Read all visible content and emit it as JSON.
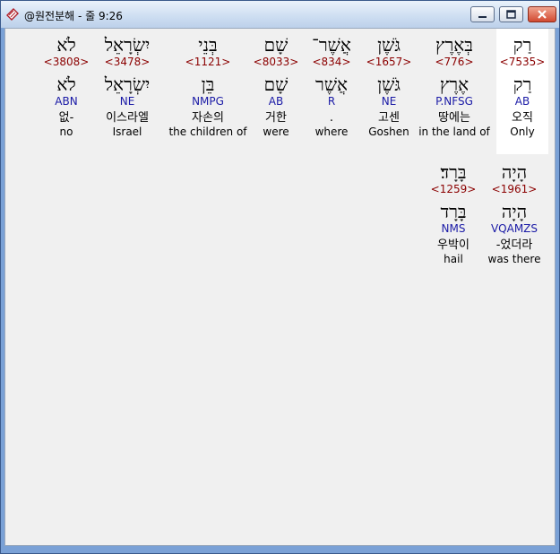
{
  "window": {
    "title": "@원전분해 - 줄 9:26",
    "icon": "bible-tool-icon"
  },
  "rows": [
    {
      "words": [
        {
          "surface": "לֹא",
          "strong": "<3808>",
          "lemma": "לֹא",
          "parse": "ABN",
          "korean": "없-",
          "english": "no"
        },
        {
          "surface": "יִשְׂרָאֵל",
          "strong": "<3478>",
          "lemma": "יִשְׂרָאֵל",
          "parse": "NE",
          "korean": "이스라엘",
          "english": "Israel"
        },
        {
          "surface": "בְּנֵי",
          "strong": "<1121>",
          "lemma": "בֵּן",
          "parse": "NMPG",
          "korean": "자손의",
          "english": "the children of"
        },
        {
          "surface": "שָׁם",
          "strong": "<8033>",
          "lemma": "שָׁם",
          "parse": "AB",
          "korean": "거한",
          "english": "were"
        },
        {
          "surface": "אֲשֶׁר־",
          "strong": "<834>",
          "lemma": "אֲשֶׁר",
          "parse": "R",
          "korean": ".",
          "english": "where"
        },
        {
          "surface": "גֹּשֶׁן",
          "strong": "<1657>",
          "lemma": "גֹּשֶׁן",
          "parse": "NE",
          "korean": "고센",
          "english": "Goshen"
        },
        {
          "surface": "בְּאֶרֶץ",
          "strong": "<776>",
          "lemma": "אֶרֶץ",
          "parse": "P.NFSG",
          "korean": "땅에는",
          "english": "in the land of"
        },
        {
          "surface": "רַק",
          "strong": "<7535>",
          "lemma": "רַק",
          "parse": "AB",
          "korean": "오직",
          "english": "Only",
          "selected": true
        }
      ]
    },
    {
      "words": [
        {
          "surface": "בָּרָד׃",
          "strong": "<1259>",
          "lemma": "בָּרָד",
          "parse": "NMS",
          "korean": "우박이",
          "english": "hail"
        },
        {
          "surface": "הָיָה",
          "strong": "<1961>",
          "lemma": "הָיָה",
          "parse": "VQAMZS",
          "korean": "-었더라",
          "english": "was there"
        }
      ]
    }
  ]
}
